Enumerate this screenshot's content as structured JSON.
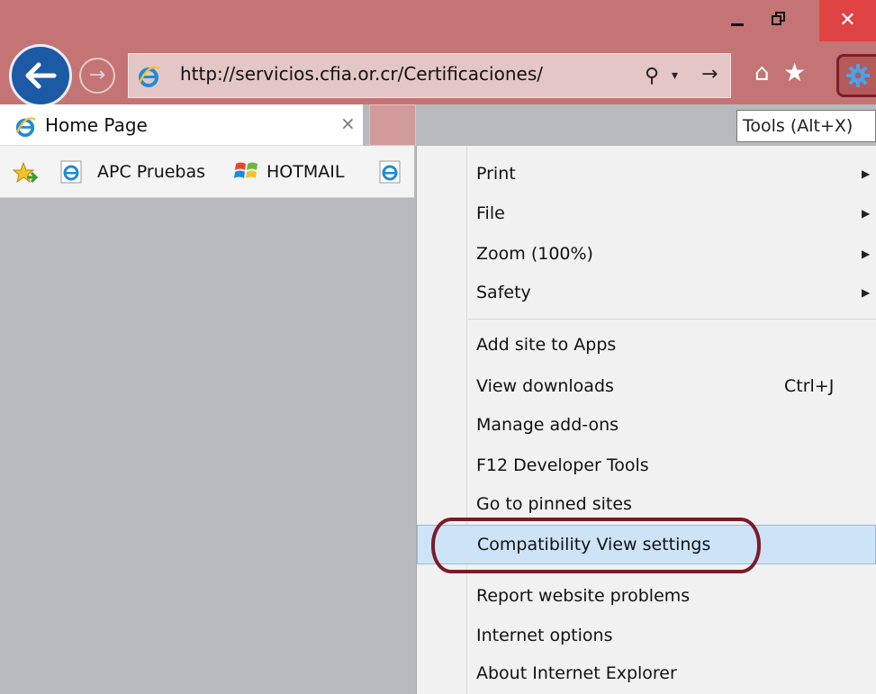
{
  "window": {
    "minimize_icon": "minimize-icon",
    "restore_icon": "restore-icon",
    "close_glyph": "✕",
    "close_color": "#e04343",
    "chrome_color": "#c47474"
  },
  "nav": {
    "address_url": "http://servicios.cfia.or.cr/Certificaciones/",
    "back_glyph": "←",
    "forward_glyph": "→",
    "search_glyph": "⚲",
    "dropdown_glyph": "▾",
    "go_glyph": "→",
    "home_glyph": "⌂",
    "favorites_glyph": "★"
  },
  "tabs": [
    {
      "label": "Home Page",
      "close_glyph": "×"
    }
  ],
  "tooltip": {
    "text": "Tools (Alt+X)"
  },
  "favorites_bar": [
    {
      "label": "APC Pruebas",
      "icon": "ie-icon"
    },
    {
      "label": "HOTMAIL",
      "icon": "windows-flag-icon"
    }
  ],
  "tools_menu": {
    "items": [
      {
        "label": "Print",
        "submenu": true
      },
      {
        "label": "File",
        "submenu": true
      },
      {
        "label": "Zoom (100%)",
        "submenu": true
      },
      {
        "label": "Safety",
        "submenu": true
      },
      {
        "label": "Add site to Apps"
      },
      {
        "label": "View downloads",
        "shortcut": "Ctrl+J"
      },
      {
        "label": "Manage add-ons"
      },
      {
        "label": "F12 Developer Tools"
      },
      {
        "label": "Go to pinned sites"
      },
      {
        "label": "Compatibility View settings",
        "highlighted": true
      },
      {
        "label": "Report website problems"
      },
      {
        "label": "Internet options"
      },
      {
        "label": "About Internet Explorer"
      }
    ],
    "submenu_glyph": "▶",
    "highlight_color": "#cde3f7",
    "annotation_color": "#7a1c28"
  }
}
